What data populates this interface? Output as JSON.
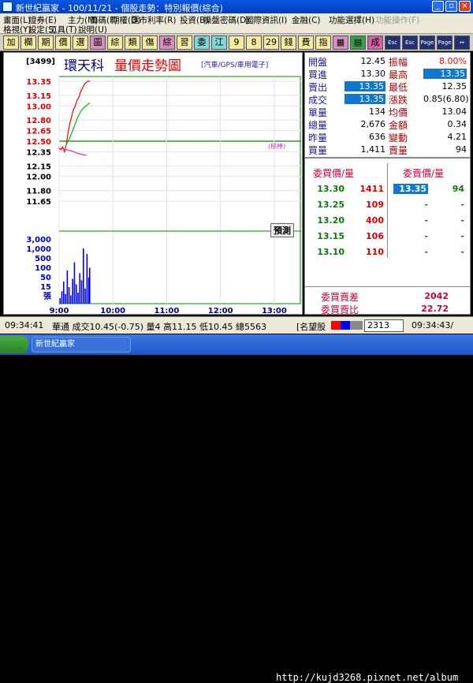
{
  "window": {
    "title": "新世紀贏家 - 100/11/21 - 個股走勢：特別報價(綜合)"
  },
  "menu": {
    "row1": [
      "畫面(L)",
      "證券(E)",
      "主力(M)",
      "籌碼(F)",
      "期權(O)",
      "匯市利率(R)",
      "投資(B)",
      "操盤密碼(D)",
      "國際資訊(I)",
      "金融(C)",
      "功能選擇(H)",
      "功能操作(F)"
    ],
    "row2": [
      "格視(Y)",
      "設定(S)",
      "工具(T)",
      "說明(U)"
    ]
  },
  "toolbar": [
    {
      "label": "加",
      "bg": "#f6ea9c"
    },
    {
      "label": "欄",
      "bg": "#f6ea9c"
    },
    {
      "label": "期",
      "bg": "#f6ea9c"
    },
    {
      "label": "價",
      "bg": "#f6ea9c"
    },
    {
      "label": "選",
      "bg": "#f6ea9c"
    },
    {
      "label": "圖",
      "bg": "#d98ec0"
    },
    {
      "label": "綜",
      "bg": "#f6ea9c"
    },
    {
      "label": "類",
      "bg": "#f6ea9c"
    },
    {
      "label": "傷",
      "bg": "#f6ea9c"
    },
    {
      "label": "綜",
      "bg": "#d98ec0"
    },
    {
      "label": "習",
      "bg": "#f6ea9c"
    },
    {
      "label": "委",
      "bg": "#7fd8d8"
    },
    {
      "label": "江",
      "bg": "#7fd8d8"
    },
    {
      "label": "9",
      "bg": "#f6ea9c"
    },
    {
      "label": "8",
      "bg": "#f6ea9c"
    },
    {
      "label": "29",
      "bg": "#f6ea9c"
    },
    {
      "label": "錢",
      "bg": "#f6ea9c"
    },
    {
      "label": "費",
      "bg": "#f6ea9c"
    },
    {
      "label": "指",
      "bg": "#f6ea9c"
    },
    {
      "label": "▦",
      "bg": "#d98ec0"
    },
    {
      "label": "▤",
      "bg": "#3c9c48"
    },
    {
      "label": "成",
      "bg": "#d060a8"
    },
    {
      "label": "Esc",
      "bg": "#203070"
    },
    {
      "label": "Esc",
      "bg": "#203070"
    },
    {
      "label": "Page",
      "bg": "#203070"
    },
    {
      "label": "Page",
      "bg": "#203070"
    },
    {
      "label": "↔",
      "bg": "#203070"
    }
  ],
  "chart": {
    "code": "[3499]",
    "name": "環天科",
    "chart_title": "量價走勢圖",
    "industry": "[汽車/GPS/車用電子]",
    "ref_label": "(極棒)",
    "badge": "預測"
  },
  "chart_data": {
    "type": "line",
    "title": "量價走勢圖",
    "price_axis": {
      "ticks": [
        "13.35",
        "13.15",
        "13.00",
        "12.80",
        "12.65",
        "12.50",
        "12.35",
        "12.15",
        "12.00",
        "11.80",
        "11.65"
      ],
      "range": [
        11.65,
        13.35
      ],
      "reference": 12.5
    },
    "volume_axis": {
      "ticks": [
        "3,000",
        "1,000",
        "500",
        "100",
        "50",
        "15"
      ],
      "unit": "張"
    },
    "time_axis": {
      "ticks": [
        "9:00",
        "10:00",
        "11:00",
        "12:00",
        "13:00"
      ]
    },
    "series": [
      {
        "name": "price",
        "color": "#ff0000",
        "x": [
          "9:00",
          "9:02",
          "9:04",
          "9:06",
          "9:08",
          "9:10",
          "9:12",
          "9:14",
          "9:16",
          "9:18",
          "9:20",
          "9:22",
          "9:24",
          "9:26",
          "9:28",
          "9:30",
          "9:32",
          "9:34"
        ],
        "values": [
          12.4,
          12.38,
          12.42,
          12.35,
          12.45,
          12.62,
          12.75,
          12.85,
          12.95,
          13.0,
          13.08,
          13.12,
          13.2,
          13.25,
          13.3,
          13.33,
          13.35,
          13.35
        ]
      },
      {
        "name": "avg",
        "color": "#00bb00",
        "x": [
          "9:08",
          "9:12",
          "9:16",
          "9:20",
          "9:24",
          "9:28",
          "9:32",
          "9:34"
        ],
        "values": [
          12.45,
          12.55,
          12.68,
          12.82,
          12.92,
          12.98,
          13.02,
          13.04
        ]
      },
      {
        "name": "bid",
        "color": "#cc33cc",
        "x": [
          "9:02",
          "9:08",
          "9:14",
          "9:20",
          "9:26",
          "9:30"
        ],
        "values": [
          12.4,
          12.38,
          12.36,
          12.33,
          12.31,
          12.3
        ]
      },
      {
        "name": "volume",
        "color": "#0000ff",
        "x": [
          "9:01",
          "9:03",
          "9:05",
          "9:07",
          "9:09",
          "9:11",
          "9:13",
          "9:15",
          "9:17",
          "9:19",
          "9:21",
          "9:23",
          "9:25",
          "9:27",
          "9:29",
          "9:31",
          "9:33",
          "9:34"
        ],
        "values": [
          20,
          45,
          80,
          35,
          120,
          60,
          30,
          90,
          150,
          70,
          40,
          110,
          85,
          200,
          55,
          180,
          95,
          130
        ]
      }
    ]
  },
  "quote": {
    "rows": [
      {
        "l1": "開盤",
        "v1": "12.45",
        "c1": "#000000",
        "l2": "振幅",
        "v2": "8.00%",
        "c2": "#ff0000"
      },
      {
        "l1": "買進",
        "v1": "13.30",
        "c1": "#000000",
        "l2": "最高",
        "v2": "13.35",
        "c2": "#ffffff",
        "h2": true
      },
      {
        "l1": "賣出",
        "v1": "13.35",
        "c1": "#ffffff",
        "h1": true,
        "l2": "最低",
        "v2": "12.35",
        "c2": "#000000"
      },
      {
        "l1": "成交",
        "v1": "13.35",
        "c1": "#ffffff",
        "h1": true,
        "l2": "漲跌",
        "v2": "0.85(6.80)",
        "c2": "#000000"
      },
      {
        "l1": "單量",
        "v1": "134",
        "c1": "#000000",
        "l2": "均價",
        "v2": "13.04",
        "c2": "#000000"
      },
      {
        "l1": "總量",
        "v1": "2,676",
        "c1": "#000000",
        "l2": "金額",
        "v2": "0.34",
        "c2": "#000000"
      },
      {
        "l1": "昨量",
        "v1": "636",
        "c1": "#000000",
        "l2": "變動",
        "v2": "4.21",
        "c2": "#000000"
      },
      {
        "l1": "買量",
        "v1": "1,411",
        "c1": "#000000",
        "l2": "賣量",
        "v2": "94",
        "c2": "#000000"
      }
    ],
    "book_header_bid": "委買價/量",
    "book_header_ask": "委賣價/量",
    "book": [
      {
        "bid": "13.30",
        "bidvol": "1411",
        "ask": "13.35",
        "askvol": "94"
      },
      {
        "bid": "13.25",
        "bidvol": "109",
        "ask": "-",
        "askvol": "-"
      },
      {
        "bid": "13.20",
        "bidvol": "400",
        "ask": "-",
        "askvol": "-"
      },
      {
        "bid": "13.15",
        "bidvol": "106",
        "ask": "-",
        "askvol": "-"
      },
      {
        "bid": "13.10",
        "bidvol": "110",
        "ask": "-",
        "askvol": "-"
      }
    ],
    "diff_label": "委買賣差",
    "diff_value": "2042",
    "ratio_label": "委買賣比",
    "ratio_value": "22.72"
  },
  "status": {
    "time": "09:34:41",
    "ticker": "華通 成交10.45(-0.75) 量4 高11.15 低10.45 總5563",
    "bracket": "[名望股",
    "code": "2313",
    "clock": "09:34:43/"
  },
  "taskbar": {
    "items": [
      "新世紀贏家"
    ],
    "watermark": "http://kujd3268.pixnet.net/album"
  }
}
